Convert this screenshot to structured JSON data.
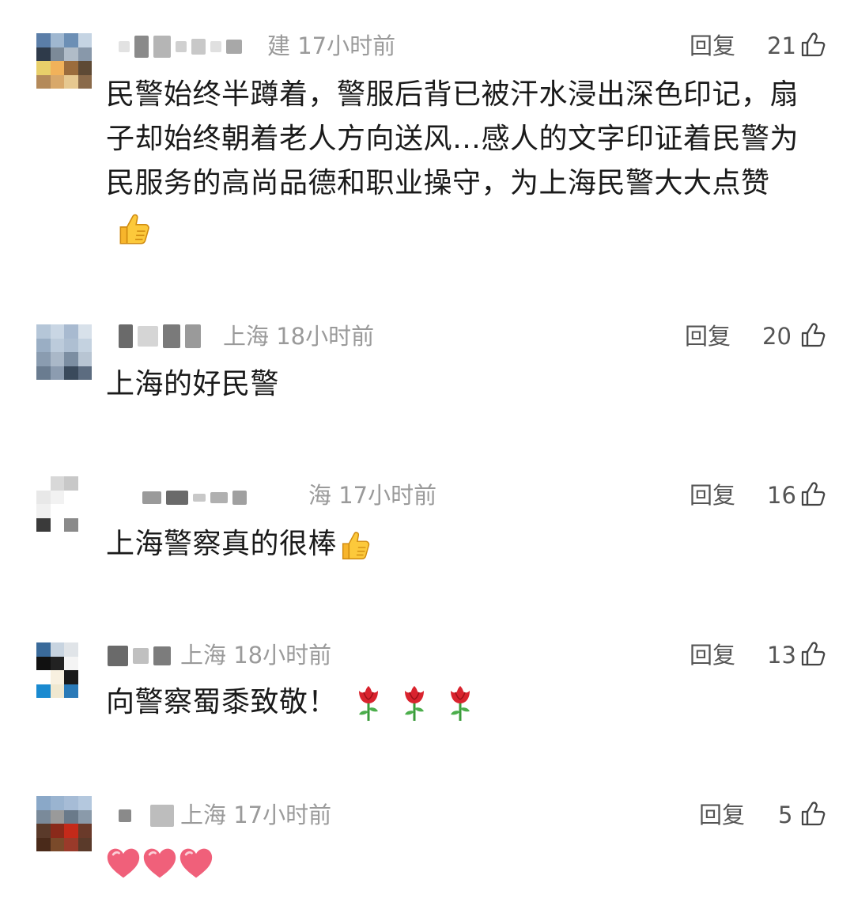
{
  "comments": [
    {
      "location_time": "建 17小时前",
      "reply_label": "回复",
      "likes": "21",
      "text": "民警始终半蹲着，警服后背已被汗水浸出深色印记，扇子却始终朝着老人方向送风…感人的文字印证着民警为民服务的高尚品德和职业操守，为上海民警大大点赞",
      "emoji": "thumbs-up"
    },
    {
      "location_time": "上海 18小时前",
      "reply_label": "回复",
      "likes": "20",
      "text": "上海的好民警",
      "emoji": ""
    },
    {
      "location_time": "海 17小时前",
      "reply_label": "回复",
      "likes": "16",
      "text": "上海警察真的很棒",
      "emoji": "thumbs-up"
    },
    {
      "location_time": "上海 18小时前",
      "reply_label": "回复",
      "likes": "13",
      "text": "向警察蜀黍致敬！",
      "emoji": "rose x3"
    },
    {
      "location_time": "上海 17小时前",
      "reply_label": "回复",
      "likes": "5",
      "text": "",
      "emoji": "heart x3"
    }
  ],
  "colors": {
    "text": "#1a1a1a",
    "meta": "#9a9a9a",
    "action": "#555555",
    "heart": "#f0607a",
    "thumb": "#f7b52c",
    "rose": "#d9232e"
  }
}
